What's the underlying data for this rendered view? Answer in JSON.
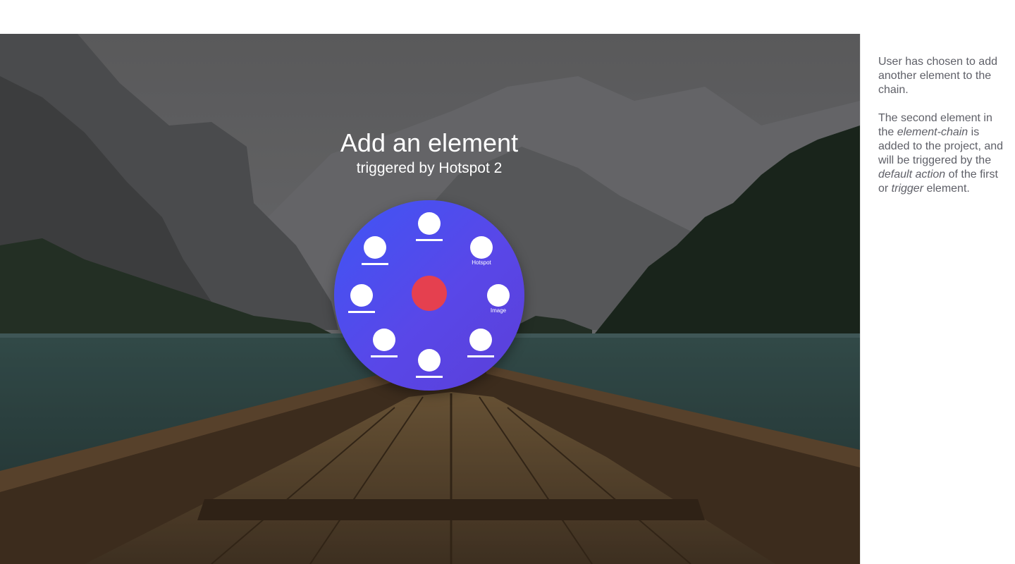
{
  "dialog": {
    "title": "Add an element",
    "subtitle": "triggered by Hotspot 2"
  },
  "wheel": {
    "options": [
      {
        "label": ""
      },
      {
        "label": "Hotspot"
      },
      {
        "label": "Image"
      },
      {
        "label": ""
      },
      {
        "label": ""
      },
      {
        "label": ""
      },
      {
        "label": ""
      },
      {
        "label": ""
      }
    ],
    "accent_color": "#5147EC",
    "center_color": "#E5404F"
  },
  "sidebar": {
    "p1": "User has chosen to add another element to the chain.",
    "p2_a": "The second element in the ",
    "p2_b": "element-chain",
    "p2_c": " is added to the project, and will be triggered by the ",
    "p2_d": "default action",
    "p2_e": " of the first or ",
    "p2_f": "trigger",
    "p2_g": " element."
  },
  "background": {
    "icon": "lake-boat-photo"
  }
}
